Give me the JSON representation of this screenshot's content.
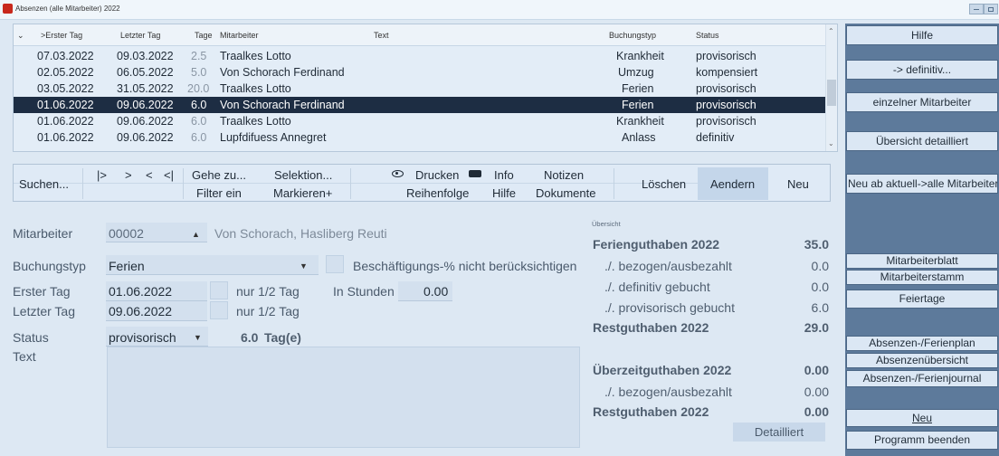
{
  "window": {
    "title": "Absenzen (alle Mitarbeiter)  2022"
  },
  "grid": {
    "columns": [
      ">Erster Tag",
      "Letzter Tag",
      "Tage",
      "Mitarbeiter",
      "Text",
      "Buchungstyp",
      "Status"
    ],
    "rows": [
      {
        "first": "07.03.2022",
        "last": "09.03.2022",
        "days": "2.5",
        "employee": "Traalkes Lotto",
        "text": "",
        "type": "Krankheit",
        "status": "provisorisch"
      },
      {
        "first": "02.05.2022",
        "last": "06.05.2022",
        "days": "5.0",
        "employee": "Von Schorach Ferdinand",
        "text": "",
        "type": "Umzug",
        "status": "kompensiert"
      },
      {
        "first": "03.05.2022",
        "last": "31.05.2022",
        "days": "20.0",
        "employee": "Traalkes Lotto",
        "text": "",
        "type": "Ferien",
        "status": "provisorisch"
      },
      {
        "first": "01.06.2022",
        "last": "09.06.2022",
        "days": "6.0",
        "employee": "Von Schorach Ferdinand",
        "text": "",
        "type": "Ferien",
        "status": "provisorisch",
        "selected": true
      },
      {
        "first": "01.06.2022",
        "last": "09.06.2022",
        "days": "6.0",
        "employee": "Traalkes Lotto",
        "text": "",
        "type": "Krankheit",
        "status": "provisorisch"
      },
      {
        "first": "01.06.2022",
        "last": "09.06.2022",
        "days": "6.0",
        "employee": "Lupfdifuess Annegret",
        "text": "",
        "type": "Anlass",
        "status": "definitiv"
      }
    ]
  },
  "toolbar": {
    "suchen": "Suchen...",
    "first": "|>",
    "next": ">",
    "prev": "<",
    "last": "<|",
    "gehe_zu": "Gehe zu...",
    "filter_ein": "Filter ein",
    "selektion": "Selektion...",
    "markieren": "Markieren+",
    "drucken": "Drucken",
    "reihenfolge": "Reihenfolge",
    "info": "Info",
    "hilfe": "Hilfe",
    "notizen": "Notizen",
    "dokumente": "Dokumente",
    "loeschen": "Löschen",
    "aendern": "Aendern",
    "neu": "Neu"
  },
  "form": {
    "mitarbeiter_label": "Mitarbeiter",
    "mitarbeiter_nr": "00002",
    "mitarbeiter_name": "Von Schorach, Hasliberg Reuti",
    "buchungstyp_label": "Buchungstyp",
    "buchungstyp_value": "Ferien",
    "beschaeftigung_label": "Beschäftigungs-% nicht berücksichtigen",
    "erster_tag_label": "Erster Tag",
    "erster_tag_value": "01.06.2022",
    "half_day_1": "nur 1/2 Tag",
    "in_stunden_label": "In Stunden",
    "in_stunden_value": "0.00",
    "letzter_tag_label": "Letzter Tag",
    "letzter_tag_value": "09.06.2022",
    "half_day_2": "nur 1/2 Tag",
    "status_label": "Status",
    "status_value": "provisorisch",
    "tage_value": "6.0",
    "tage_unit": "Tag(e)",
    "text_label": "Text",
    "text_value": ""
  },
  "overview": {
    "heading": "Übersicht",
    "ferien_title": "Ferienguthaben 2022",
    "ferien_value": "35.0",
    "bezogen_label": "./. bezogen/ausbezahlt",
    "bezogen_value": "0.0",
    "definitiv_label": "./. definitiv gebucht",
    "definitiv_value": "0.0",
    "provisorisch_label": "./. provisorisch gebucht",
    "provisorisch_value": "6.0",
    "rest_title": "Restguthaben 2022",
    "rest_value": "29.0",
    "ueberzeit_title": "Überzeitguthaben 2022",
    "ueberzeit_value": "0.00",
    "ue_bezogen_label": "./. bezogen/ausbezahlt",
    "ue_bezogen_value": "0.00",
    "ue_rest_title": "Restguthaben 2022",
    "ue_rest_value": "0.00",
    "detailliert": "Detailliert"
  },
  "side": {
    "hilfe": "Hilfe",
    "definitiv": "-> definitiv...",
    "einzelner": "einzelner Mitarbeiter",
    "uebersicht": "Übersicht detailliert",
    "neu_ab": "Neu ab aktuell->alle Mitarbeiter",
    "blatt": "Mitarbeiterblatt",
    "stamm": "Mitarbeiterstamm",
    "feiertage": "Feiertage",
    "plan": "Absenzen-/Ferienplan",
    "absenzenuebersicht": "Absenzenübersicht",
    "journal": "Absenzen-/Ferienjournal",
    "neu": "Neu",
    "beenden": "Programm beenden"
  }
}
